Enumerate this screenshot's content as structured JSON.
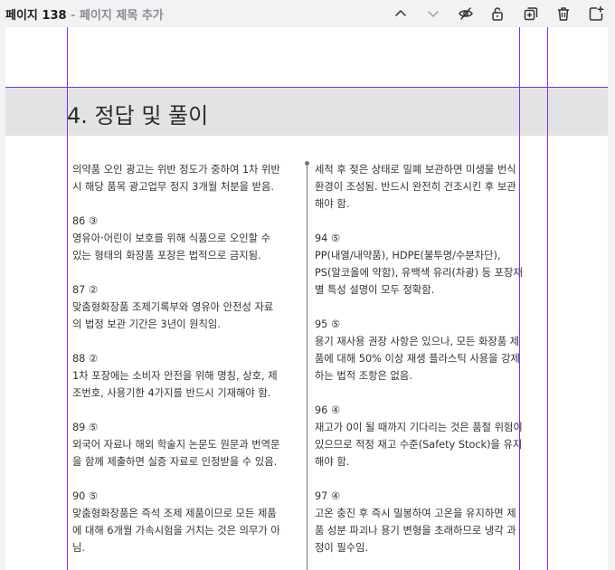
{
  "toolbar": {
    "page_number": "페이지 138",
    "separator": " - ",
    "page_title_placeholder": "페이지 제목 추가",
    "icons": [
      "chevron-up-icon",
      "chevron-down-icon",
      "eye-off-icon",
      "unlock-icon",
      "duplicate-icon",
      "trash-icon",
      "add-page-icon"
    ]
  },
  "content": {
    "heading": "4. 정답 및 풀이",
    "left_column": [
      {
        "lines": [
          "의약품 오인 광고는 위반 정도가 중하여 1차 위반",
          "시 해당 품목 광고업무 정지 3개월 처분을 받음."
        ]
      },
      {
        "lines": [
          "86 ③",
          "영유아·어린이 보호를 위해 식품으로 오인할 수",
          "있는 형태의 화장품 포장은 법적으로 금지됨."
        ]
      },
      {
        "lines": [
          "87 ②",
          "맞춤형화장품 조제기록부와 영유아 안전성 자료",
          "의 법정 보관 기간은 3년이 원칙임."
        ]
      },
      {
        "lines": [
          "88 ②",
          "1차 포장에는 소비자 안전을 위해 명칭, 상호, 제",
          "조번호, 사용기한 4가지를 반드시 기재해야 함."
        ]
      },
      {
        "lines": [
          "89 ⑤",
          "외국어 자료나 해외 학술지 논문도 원문과 번역문",
          "을 함께 제출하면 실증 자료로 인정받을 수 있음."
        ]
      },
      {
        "lines": [
          "90 ⑤",
          "맞춤형화장품은 즉석 조제 제품이므로 모든 제품",
          "에 대해 6개월 가속시험을 거치는 것은 의무가 아",
          "님."
        ]
      }
    ],
    "right_column": [
      {
        "lines": [
          "세척 후 젖은 상태로 밀폐 보관하면 미생물 번식",
          "환경이 조성됨. 반드시 완전히 건조시킨 후 보관",
          "해야 함."
        ]
      },
      {
        "lines": [
          "94 ⑤",
          "PP(내열/내약품), HDPE(불투명/수분차단),",
          "PS(알코올에 약함), 유백색 유리(차광) 등 포장재",
          "별 특성 설명이 모두 정확함."
        ]
      },
      {
        "lines": [
          "95 ⑤",
          "용기 재사용 권장 사항은 있으나, 모든 화장품 제",
          "품에 대해 50% 이상 재생 플라스틱 사용을 강제",
          "하는 법적 조항은 없음."
        ]
      },
      {
        "lines": [
          "96 ④",
          "재고가 0이 될 때까지 기다리는 것은 품절 위험이",
          "있으므로 적정 재고 수준(Safety Stock)을 유지",
          "해야 함."
        ]
      },
      {
        "lines": [
          "97 ④",
          "고온 충진 후 즉시 밀봉하여 고온을 유지하면 제",
          "품 성분 파괴나 용기 변형을 초래하므로 냉각 과",
          "정이 필수임."
        ]
      }
    ]
  },
  "colors": {
    "guide": "#7b2fff",
    "band": "#e3e3e5",
    "canvas": "#ffffff",
    "chrome": "#f2f2f4"
  }
}
